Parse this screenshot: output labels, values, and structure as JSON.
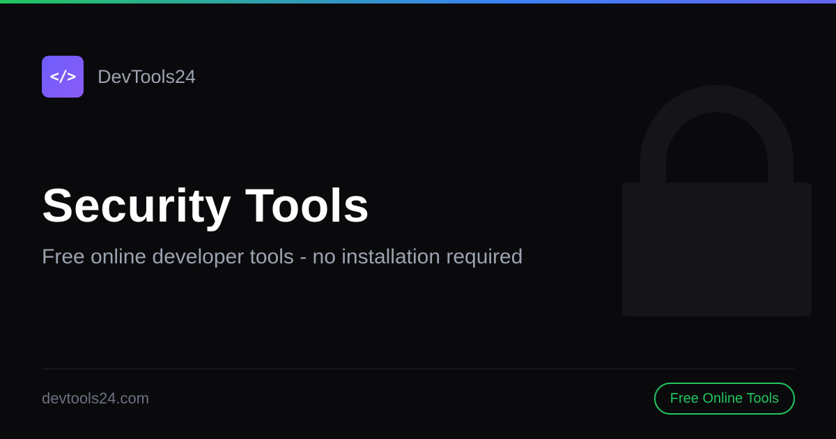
{
  "brand": {
    "logo_text": "</>",
    "name": "DevTools24"
  },
  "hero": {
    "title": "Security Tools",
    "subtitle": "Free online developer tools - no installation required",
    "background_icon": "lock-icon"
  },
  "footer": {
    "domain": "devtools24.com",
    "cta_label": "Free Online Tools"
  },
  "colors": {
    "background": "#0a0a0d",
    "accent_green": "#22c55e",
    "logo_purple": "#7c5cf6",
    "gradient_start": "#22c55e",
    "gradient_end": "#6366f1",
    "muted_text": "#9ca3af"
  }
}
